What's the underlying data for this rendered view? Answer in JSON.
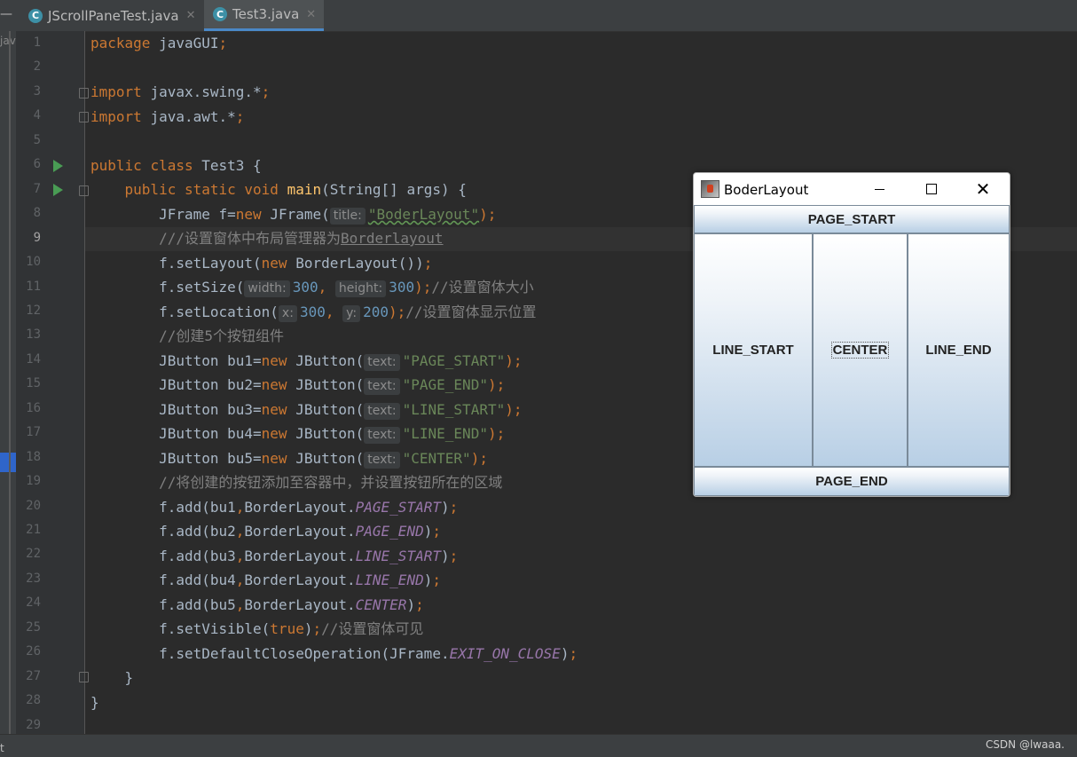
{
  "tabs": [
    {
      "label": "JScrollPaneTest.java",
      "active": false
    },
    {
      "label": "Test3.java",
      "active": true
    }
  ],
  "left_strip_text": "jav",
  "editor": {
    "line_numbers": [
      "1",
      "2",
      "3",
      "4",
      "5",
      "6",
      "7",
      "8",
      "9",
      "10",
      "11",
      "12",
      "13",
      "14",
      "15",
      "16",
      "17",
      "18",
      "19",
      "20",
      "21",
      "22",
      "23",
      "24",
      "25",
      "26",
      "27",
      "28",
      "29"
    ],
    "current_line": "9"
  },
  "code": {
    "package_kw": "package",
    "package_name": "javaGUI",
    "semi": ";",
    "import_kw": "import",
    "import1": "javax.swing.*",
    "import2": "java.awt.*",
    "public": "public",
    "class": "class",
    "class_name": "Test3 {",
    "static": "static",
    "void": "void",
    "main": "main",
    "main_args": "(String[] args) {",
    "l8_a": "JFrame f=",
    "new": "new",
    "l8_b": "JFrame(",
    "hint_title": "title:",
    "l8_str": "\"BoderLayout\"",
    "l8_end": ");",
    "l9_cm": "///设置窗体中布局管理器为",
    "l9_cm2": "Borderlayout",
    "l10_a": "f.setLayout(",
    "l10_b": "BorderLayout())",
    "l11_a": "f.setSize(",
    "hint_width": "width:",
    "num_300": "300",
    "comma": ",",
    "hint_height": "height:",
    "l11_end": ");",
    "l11_cm": "//设置窗体大小",
    "l12_a": "f.setLocation(",
    "hint_x": "x:",
    "hint_y": "y:",
    "num_200": "200",
    "l12_cm": "//设置窗体显示位置",
    "l13_cm": "//创建5个按钮组件",
    "bu1": "JButton bu1=",
    "bu2": "JButton bu2=",
    "bu3": "JButton bu3=",
    "bu4": "JButton bu4=",
    "bu5": "JButton bu5=",
    "jbutton": "JButton(",
    "hint_text": "text:",
    "s_page_start": "\"PAGE_START\"",
    "s_page_end": "\"PAGE_END\"",
    "s_line_start": "\"LINE_START\"",
    "s_line_end": "\"LINE_END\"",
    "s_center": "\"CENTER\"",
    "l19_cm": "//将创建的按钮添加至容器中，并设置按钮所在的区域",
    "add1": "f.add(bu1",
    "add2": "f.add(bu2",
    "add3": "f.add(bu3",
    "add4": "f.add(bu4",
    "add5": "f.add(bu5",
    "bl": "BorderLayout.",
    "close_paren": ")",
    "c_page_start": "PAGE_START",
    "c_page_end": "PAGE_END",
    "c_line_start": "LINE_START",
    "c_line_end": "LINE_END",
    "c_center": "CENTER",
    "l25_a": "f.setVisible(",
    "true": "true",
    "l25_cm": "//设置窗体可见",
    "l26_a": "f.setDefaultCloseOperation(JFrame.",
    "exit": "EXIT_ON_CLOSE",
    "brace": "}"
  },
  "swing_window": {
    "title": "BoderLayout",
    "buttons": {
      "page_start": "PAGE_START",
      "line_start": "LINE_START",
      "center": "CENTER",
      "line_end": "LINE_END",
      "page_end": "PAGE_END"
    }
  },
  "status": {
    "left_text": "t",
    "watermark": "CSDN @lwaaa."
  },
  "colors": {
    "keyword": "#cc7832",
    "string": "#6a8759",
    "number": "#6897bb",
    "comment": "#808080",
    "constant": "#9876aa",
    "function": "#ffc66d"
  }
}
